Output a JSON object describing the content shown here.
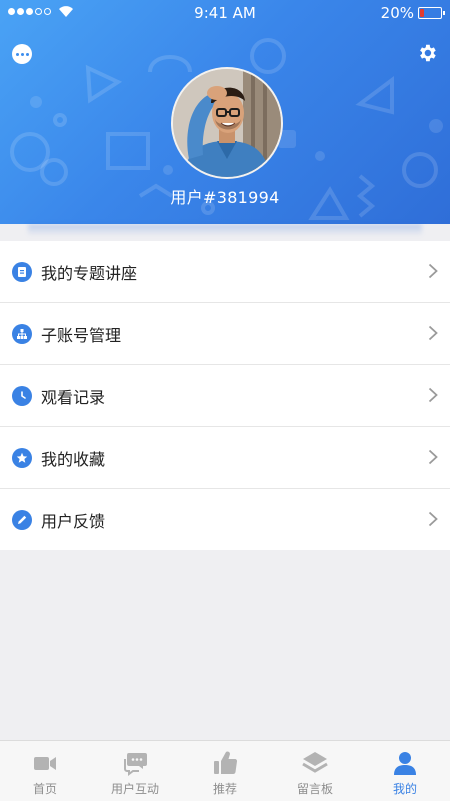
{
  "status_bar": {
    "time": "9:41 AM",
    "battery_percent": "20%",
    "battery_level": 0.2,
    "battery_color": "#e23b2f"
  },
  "header": {
    "username": "用户#381994",
    "gradient_start": "#4aa3f5",
    "gradient_end": "#2f6ed8"
  },
  "menu": {
    "items": [
      {
        "label": "我的专题讲座",
        "icon": "clipboard-icon"
      },
      {
        "label": "子账号管理",
        "icon": "org-chart-icon"
      },
      {
        "label": "观看记录",
        "icon": "clock-icon"
      },
      {
        "label": "我的收藏",
        "icon": "star-icon"
      },
      {
        "label": "用户反馈",
        "icon": "pencil-icon"
      }
    ]
  },
  "tabbar": {
    "active_color": "#3a82e4",
    "inactive_color": "#b3b3b3",
    "tabs": [
      {
        "label": "首页",
        "icon": "video-camera-icon"
      },
      {
        "label": "用户互动",
        "icon": "chat-bubbles-icon"
      },
      {
        "label": "推荐",
        "icon": "thumbs-up-icon"
      },
      {
        "label": "留言板",
        "icon": "layers-icon"
      },
      {
        "label": "我的",
        "icon": "person-icon",
        "active": true
      }
    ]
  }
}
